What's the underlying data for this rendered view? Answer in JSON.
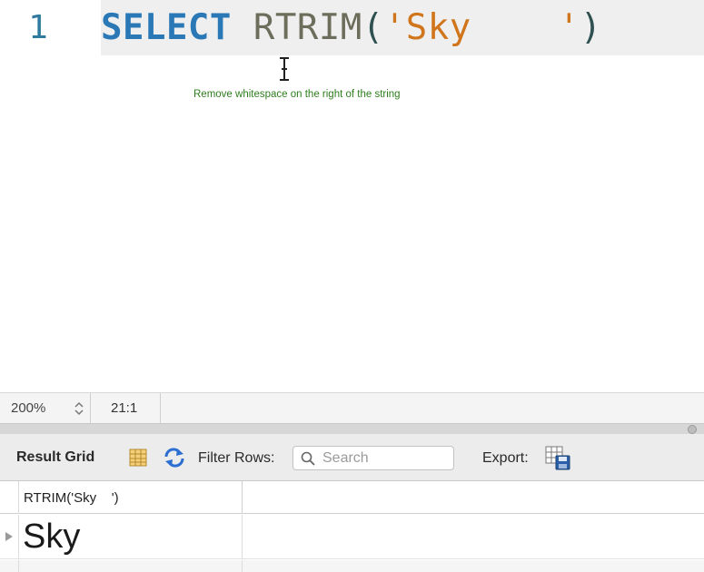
{
  "editor": {
    "line_number": "1",
    "tokens": {
      "keyword": "SELECT",
      "function": "RTRIM",
      "open_paren": "(",
      "string": "'Sky    '",
      "close_paren": ")"
    },
    "annotation": "Remove whitespace on the right of the string"
  },
  "status_bar": {
    "zoom": "200%",
    "cursor_position": "21:1"
  },
  "result_toolbar": {
    "title": "Result Grid",
    "filter_label": "Filter Rows:",
    "search_placeholder": "Search",
    "export_label": "Export:",
    "icons": [
      "grid-layout-icon",
      "refresh-icon",
      "search-icon",
      "export-icon",
      "row-pointer-icon",
      "text-cursor-icon",
      "zoom-stepper-icon"
    ]
  },
  "result_grid": {
    "columns": [
      "RTRIM('Sky    ')"
    ],
    "rows": [
      [
        "Sky"
      ]
    ]
  },
  "colors": {
    "keyword": "#2a78b5",
    "function": "#6d6d5c",
    "string": "#d0751b",
    "line_number": "#2f7a9e",
    "annotation": "#2e7d1e"
  }
}
